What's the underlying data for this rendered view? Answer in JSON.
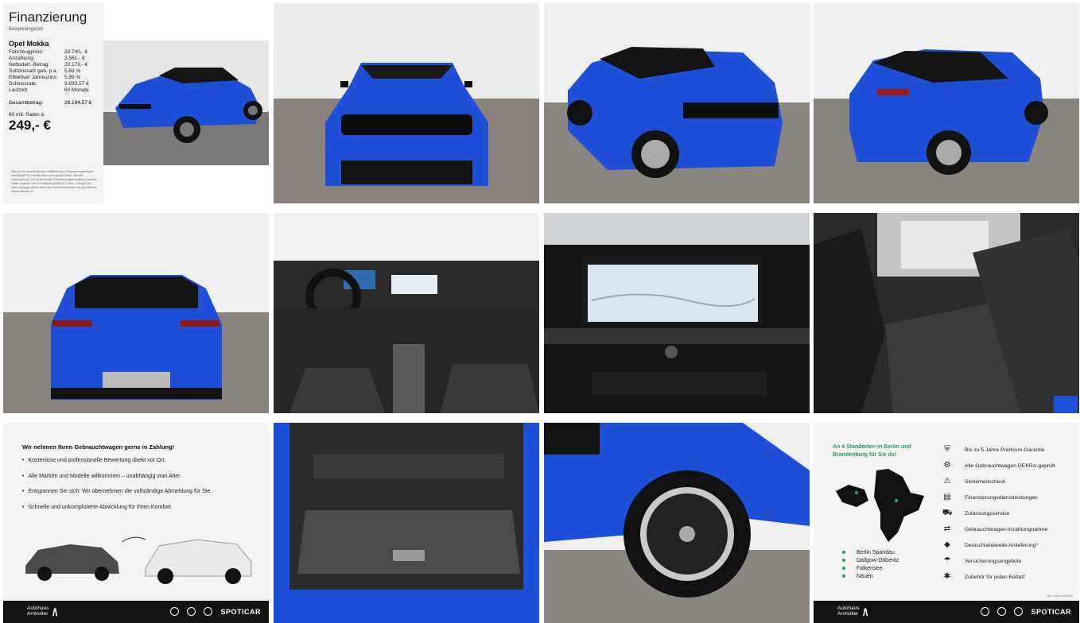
{
  "finance": {
    "title": "Finanzierung",
    "subtitle": "Beispielangebot",
    "model": "Opel Mokka",
    "rows": [
      {
        "k": "Fahrzeugpreis:",
        "v": "23.740,- €"
      },
      {
        "k": "Anzahlung:",
        "v": "3.561,- €"
      },
      {
        "k": "Nettodarl.-Betrag:",
        "v": "20.179,- €"
      },
      {
        "k": "Sollzinssatz geb. p.a.:",
        "v": "5,83 %"
      },
      {
        "k": "Effektiver Jahreszins:",
        "v": "5,99 %"
      },
      {
        "k": "Schlussrate:",
        "v": "9.693,57 €"
      },
      {
        "k": "Laufzeit:",
        "v": "60 Monate"
      }
    ],
    "total_label": "Gesamtbetrag:",
    "total_value": "28.194,57 €",
    "rate_label": "60 mtl. Raten à",
    "rate_value": "249,- €",
    "fine_print": "Dies ist ein unverbindliches, freibleibendes Finanzierungsbeispiel ihrer Bank® für Privatkunden und Handel GmbH. Bonität vorausgesetzt. Die vorstehenden Finanzierungsbeispiele je Laufzeit stellen zugleich das 2/3 Beispiel gemäß § 17 Abs. 4 PAngV dar. Nach Vertragsschluss steht dem Darlehensnehmer ein gesetzliches Widerrufsrecht zu."
  },
  "trade_in": {
    "title": "Wir nehmen Ihren Gebrauchtwagen gerne in Zahlung!",
    "items": [
      "Kostenlose und professionelle Bewertung direkt vor Ort.",
      "Alle Marken und Modelle willkommen – unabhängig vom Alter.",
      "Entspannen Sie sich: Wir übernehmen die vollständige Abmeldung für Sie.",
      "Schnelle und unkomplizierte Abwicklung für Ihren Komfort."
    ]
  },
  "footer": {
    "brand_line1": "Autohaus",
    "brand_line2": "Arnholter",
    "brand_mark": "/\\",
    "partner": "SPOTICAR"
  },
  "locations": {
    "headline": "An 4 Standorten in Berlin und Brandenburg für Sie da!",
    "places": [
      "Berlin Spandau",
      "Dallgow-Döberitz",
      "Falkensee",
      "Nauen"
    ],
    "services": [
      {
        "icon": "shield-check-icon",
        "label": "Bis zu 5 Jahre Premium-Garantie"
      },
      {
        "icon": "tools-icon",
        "label": "Alle Gebrauchtwagen DEKRA-geprüft"
      },
      {
        "icon": "warning-triangle-icon",
        "label": "Sicherheitscheck"
      },
      {
        "icon": "finance-icon",
        "label": "Finanzierungsdienstleistungen"
      },
      {
        "icon": "car-icon",
        "label": "Zulassungsservice"
      },
      {
        "icon": "tradein-icon",
        "label": "Gebrauchtwagen-Inzahlungnahme"
      },
      {
        "icon": "germany-icon",
        "label": "Deutschlandweite Anlieferung*"
      },
      {
        "icon": "insurance-icon",
        "label": "Versicherungsangebote"
      },
      {
        "icon": "accessory-icon",
        "label": "Zubehör für jeden Bedarf"
      }
    ],
    "note": "*ggf. aufpreispflichtig"
  },
  "colors": {
    "car_blue": "#1f4fd6",
    "accent_green": "#2a9d5c",
    "footer_bg": "#111111"
  }
}
